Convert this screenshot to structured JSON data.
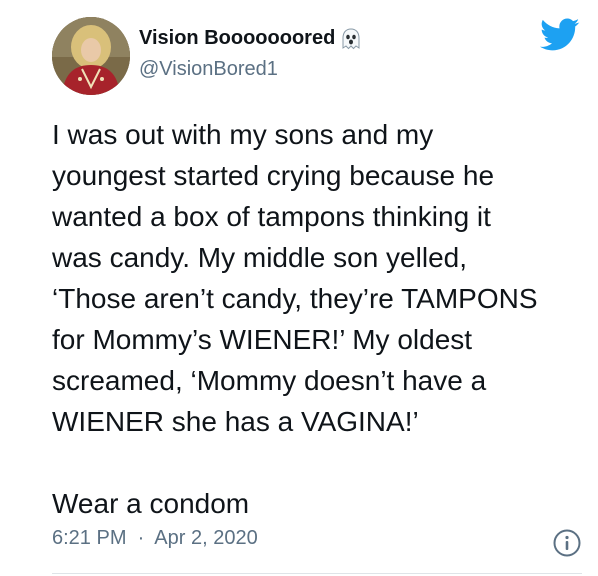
{
  "author": {
    "display_name": "Vision Booooooored",
    "handle": "@VisionBored1",
    "badge_icon": "ghost-emoji-icon"
  },
  "platform_icon": "twitter-bird-icon",
  "brand_color": "#1da1f2",
  "tweet": {
    "lines": [
      "I was out with my sons and my",
      "youngest started crying because he",
      "wanted a box of tampons thinking it",
      "was candy. My middle son yelled,",
      "‘Those aren’t candy, they’re TAMPONS",
      "for Mommy’s WIENER!’ My oldest",
      "screamed, ‘Mommy doesn’t have a",
      "WIENER she has a VAGINA!’"
    ],
    "closing_line": "Wear a condom"
  },
  "meta": {
    "time": "6:21 PM",
    "separator": "·",
    "date": "Apr 2, 2020"
  }
}
